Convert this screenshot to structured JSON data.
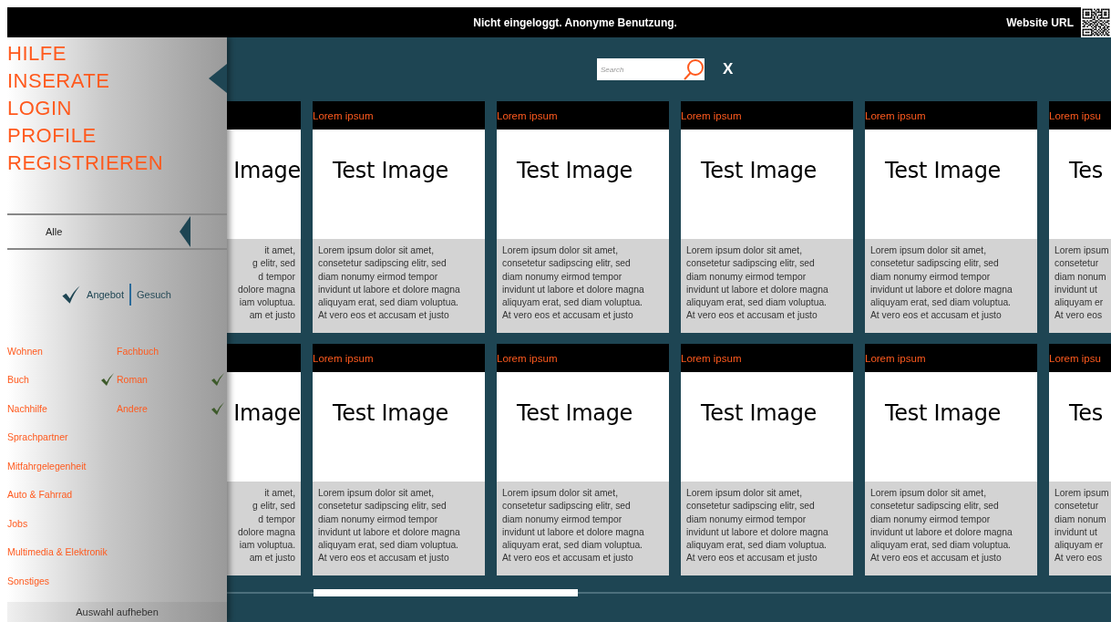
{
  "top_bar": {
    "status": "Nicht eingeloggt. Anonyme Benutzung.",
    "website_label": "Website URL"
  },
  "menu": [
    "HILFE",
    "INSERATE",
    "LOGIN",
    "PROFILE",
    "REGISTRIEREN"
  ],
  "filter": {
    "value": "Alle"
  },
  "offer_type": [
    {
      "label": "Angebot",
      "selected": true
    },
    {
      "label": "Gesuch",
      "selected": false
    }
  ],
  "categories": [
    {
      "label": "Wohnen",
      "checked": false
    },
    {
      "label": "Buch",
      "checked": true,
      "children": [
        {
          "label": "Fachbuch",
          "checked": false
        },
        {
          "label": "Roman",
          "checked": true
        },
        {
          "label": "Andere",
          "checked": true
        }
      ]
    },
    {
      "label": "Nachhilfe",
      "checked": false
    },
    {
      "label": "Sprachpartner",
      "checked": false
    },
    {
      "label": "Mitfahrgelegenheit",
      "checked": false
    },
    {
      "label": "Auto & Fahrrad",
      "checked": false
    },
    {
      "label": "Jobs",
      "checked": false
    },
    {
      "label": "Multimedia & Elektronik",
      "checked": false
    },
    {
      "label": "Sonstiges",
      "checked": false
    }
  ],
  "clear_button": "Auswahl aufheben",
  "search": {
    "placeholder": "Search",
    "close": "X"
  },
  "card_rows": [
    [
      {
        "kind": "cut_left",
        "image_text": "Image",
        "lines": [
          "it amet,",
          "g elitr, sed",
          "d tempor",
          "dolore magna",
          "iam voluptua.",
          "am et justo"
        ]
      },
      {
        "kind": "full",
        "title": "Lorem ipsum",
        "image_text": "Test Image",
        "lines": [
          "Lorem ipsum dolor sit amet,",
          "consetetur sadipscing elitr, sed",
          "diam nonumy eirmod tempor",
          "invidunt ut labore et dolore magna",
          "aliquyam erat, sed diam voluptua.",
          "At vero eos et accusam et justo"
        ]
      },
      {
        "kind": "full",
        "title": "Lorem ipsum",
        "image_text": "Test Image",
        "lines": [
          "Lorem ipsum dolor sit amet,",
          "consetetur sadipscing elitr, sed",
          "diam nonumy eirmod tempor",
          "invidunt ut labore et dolore magna",
          "aliquyam erat, sed diam voluptua.",
          "At vero eos et accusam et justo"
        ]
      },
      {
        "kind": "full",
        "title": "Lorem ipsum",
        "image_text": "Test Image",
        "lines": [
          "Lorem ipsum dolor sit amet,",
          "consetetur sadipscing elitr, sed",
          "diam nonumy eirmod tempor",
          "invidunt ut labore et dolore magna",
          "aliquyam erat, sed diam voluptua.",
          "At vero eos et accusam et justo"
        ]
      },
      {
        "kind": "full",
        "title": "Lorem ipsum",
        "image_text": "Test Image",
        "lines": [
          "Lorem ipsum dolor sit amet,",
          "consetetur sadipscing elitr, sed",
          "diam nonumy eirmod tempor",
          "invidunt ut labore et dolore magna",
          "aliquyam erat, sed diam voluptua.",
          "At vero eos et accusam et justo"
        ]
      },
      {
        "kind": "cut_right",
        "title": "Lorem ipsu",
        "image_text": "Tes",
        "lines": [
          "Lorem ipsum",
          "consetetur",
          "diam nonum",
          "invidunt ut",
          "aliquyam er",
          "At vero eos"
        ]
      }
    ],
    [
      {
        "kind": "cut_left",
        "image_text": "Image",
        "lines": [
          "it amet,",
          "g elitr, sed",
          "d tempor",
          "dolore magna",
          "iam voluptua.",
          "am et justo"
        ]
      },
      {
        "kind": "full",
        "title": "Lorem ipsum",
        "image_text": "Test Image",
        "lines": [
          "Lorem ipsum dolor sit amet,",
          "consetetur sadipscing elitr, sed",
          "diam nonumy eirmod tempor",
          "invidunt ut labore et dolore magna",
          "aliquyam erat, sed diam voluptua.",
          "At vero eos et accusam et justo"
        ]
      },
      {
        "kind": "full",
        "title": "Lorem ipsum",
        "image_text": "Test Image",
        "lines": [
          "Lorem ipsum dolor sit amet,",
          "consetetur sadipscing elitr, sed",
          "diam nonumy eirmod tempor",
          "invidunt ut labore et dolore magna",
          "aliquyam erat, sed diam voluptua.",
          "At vero eos et accusam et justo"
        ]
      },
      {
        "kind": "full",
        "title": "Lorem ipsum",
        "image_text": "Test Image",
        "lines": [
          "Lorem ipsum dolor sit amet,",
          "consetetur sadipscing elitr, sed",
          "diam nonumy eirmod tempor",
          "invidunt ut labore et dolore magna",
          "aliquyam erat, sed diam voluptua.",
          "At vero eos et accusam et justo"
        ]
      },
      {
        "kind": "full",
        "title": "Lorem ipsum",
        "image_text": "Test Image",
        "lines": [
          "Lorem ipsum dolor sit amet,",
          "consetetur sadipscing elitr, sed",
          "diam nonumy eirmod tempor",
          "invidunt ut labore et dolore magna",
          "aliquyam erat, sed diam voluptua.",
          "At vero eos et accusam et justo"
        ]
      },
      {
        "kind": "cut_right",
        "title": "Lorem ipsu",
        "image_text": "Tes",
        "lines": [
          "Lorem ipsum",
          "consetetur",
          "diam nonum",
          "invidunt ut",
          "aliquyam er",
          "At vero eos"
        ]
      }
    ]
  ]
}
